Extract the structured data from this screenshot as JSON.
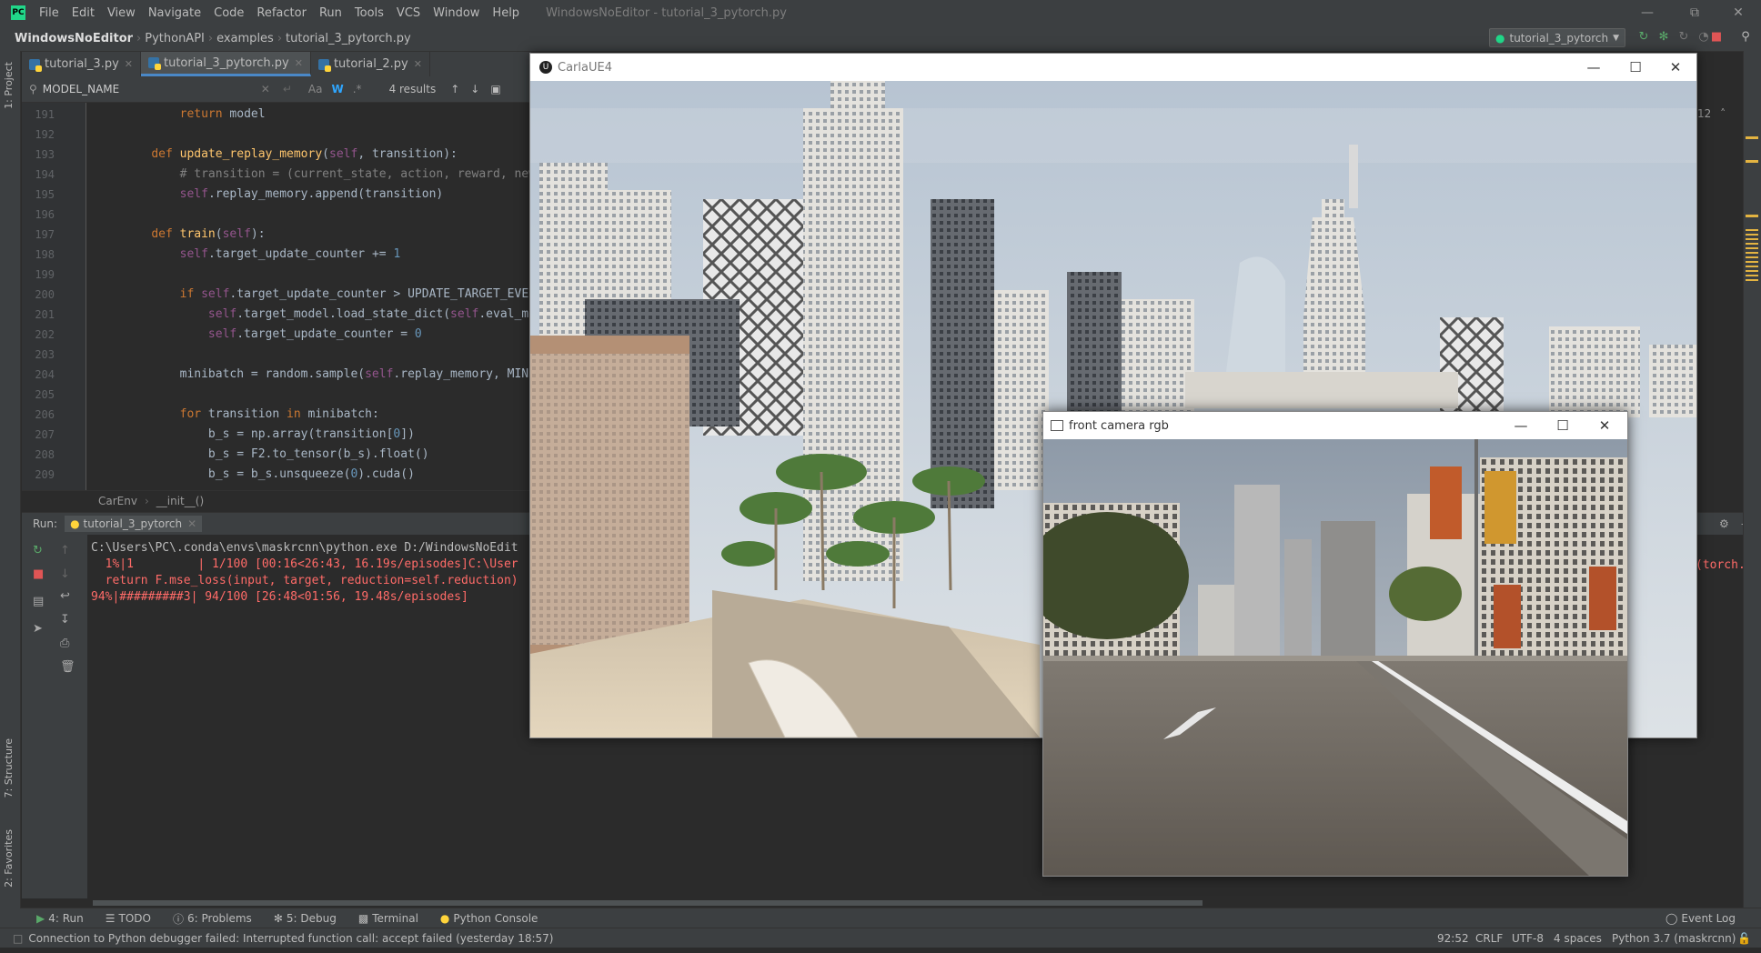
{
  "app": {
    "window_title": "WindowsNoEditor - tutorial_3_pytorch.py",
    "menu": [
      "File",
      "Edit",
      "View",
      "Navigate",
      "Code",
      "Refactor",
      "Run",
      "Tools",
      "VCS",
      "Window",
      "Help"
    ]
  },
  "nav": {
    "crumbs": [
      "WindowsNoEditor",
      "PythonAPI",
      "examples",
      "tutorial_3_pytorch.py"
    ],
    "run_config": "tutorial_3_pytorch"
  },
  "left_strip": {
    "project": "1: Project",
    "structure": "7: Structure",
    "favorites": "2: Favorites"
  },
  "tabs": [
    {
      "label": "tutorial_3.py"
    },
    {
      "label": "tutorial_3_pytorch.py"
    },
    {
      "label": "tutorial_2.py"
    }
  ],
  "search": {
    "query": "MODEL_NAME",
    "results": "4 results",
    "match_case": "Aa",
    "words": "W",
    "regex": ".*"
  },
  "editor": {
    "lines": [
      {
        "n": "191",
        "parts": [
          {
            "t": "        ",
            "c": ""
          },
          {
            "t": "return",
            "c": "kw"
          },
          {
            "t": " model",
            "c": ""
          }
        ]
      },
      {
        "n": "192",
        "parts": []
      },
      {
        "n": "193",
        "parts": [
          {
            "t": "    ",
            "c": ""
          },
          {
            "t": "def",
            "c": "kw"
          },
          {
            "t": " ",
            "c": ""
          },
          {
            "t": "update_replay_memory",
            "c": "fn"
          },
          {
            "t": "(",
            "c": ""
          },
          {
            "t": "self",
            "c": "self"
          },
          {
            "t": ", transition):",
            "c": ""
          }
        ]
      },
      {
        "n": "194",
        "parts": [
          {
            "t": "        # transition = (current_state, action, reward, new_s",
            "c": "cm"
          }
        ]
      },
      {
        "n": "195",
        "parts": [
          {
            "t": "        ",
            "c": ""
          },
          {
            "t": "self",
            "c": "self"
          },
          {
            "t": ".replay_memory.append(transition)",
            "c": ""
          }
        ]
      },
      {
        "n": "196",
        "parts": []
      },
      {
        "n": "197",
        "parts": [
          {
            "t": "    ",
            "c": ""
          },
          {
            "t": "def",
            "c": "kw"
          },
          {
            "t": " ",
            "c": ""
          },
          {
            "t": "train",
            "c": "fn"
          },
          {
            "t": "(",
            "c": ""
          },
          {
            "t": "self",
            "c": "self"
          },
          {
            "t": "):",
            "c": ""
          }
        ]
      },
      {
        "n": "198",
        "parts": [
          {
            "t": "        ",
            "c": ""
          },
          {
            "t": "self",
            "c": "self"
          },
          {
            "t": ".target_update_counter += ",
            "c": ""
          },
          {
            "t": "1",
            "c": "num"
          }
        ]
      },
      {
        "n": "199",
        "parts": []
      },
      {
        "n": "200",
        "parts": [
          {
            "t": "        ",
            "c": ""
          },
          {
            "t": "if",
            "c": "kw"
          },
          {
            "t": " ",
            "c": ""
          },
          {
            "t": "self",
            "c": "self"
          },
          {
            "t": ".target_update_counter > UPDATE_TARGET_EVERY",
            "c": ""
          }
        ]
      },
      {
        "n": "201",
        "parts": [
          {
            "t": "            ",
            "c": ""
          },
          {
            "t": "self",
            "c": "self"
          },
          {
            "t": ".target_model.load_state_dict(",
            "c": ""
          },
          {
            "t": "self",
            "c": "self"
          },
          {
            "t": ".eval_mode",
            "c": ""
          }
        ]
      },
      {
        "n": "202",
        "parts": [
          {
            "t": "            ",
            "c": ""
          },
          {
            "t": "self",
            "c": "self"
          },
          {
            "t": ".target_update_counter = ",
            "c": ""
          },
          {
            "t": "0",
            "c": "num"
          }
        ]
      },
      {
        "n": "203",
        "parts": []
      },
      {
        "n": "204",
        "parts": [
          {
            "t": "        minibatch = random.sample(",
            "c": ""
          },
          {
            "t": "self",
            "c": "self"
          },
          {
            "t": ".replay_memory, MINIBA",
            "c": ""
          }
        ]
      },
      {
        "n": "205",
        "parts": []
      },
      {
        "n": "206",
        "parts": [
          {
            "t": "        ",
            "c": ""
          },
          {
            "t": "for",
            "c": "kw"
          },
          {
            "t": " transition ",
            "c": ""
          },
          {
            "t": "in",
            "c": "kw"
          },
          {
            "t": " minibatch:",
            "c": ""
          }
        ]
      },
      {
        "n": "207",
        "parts": [
          {
            "t": "            b_s = np.array(transition[",
            "c": ""
          },
          {
            "t": "0",
            "c": "num"
          },
          {
            "t": "])",
            "c": ""
          }
        ]
      },
      {
        "n": "208",
        "parts": [
          {
            "t": "            b_s = F2.to_tensor(b_s).float()",
            "c": ""
          }
        ]
      },
      {
        "n": "209",
        "parts": [
          {
            "t": "            b_s = b_s.unsqueeze(",
            "c": ""
          },
          {
            "t": "0",
            "c": "num"
          },
          {
            "t": ").cuda()",
            "c": ""
          }
        ]
      }
    ],
    "inlay_count": "12",
    "breadcrumb": [
      "CarEnv",
      "__init__()"
    ]
  },
  "run": {
    "label": "Run:",
    "tab": "tutorial_3_pytorch",
    "console": [
      {
        "text": "C:\\Users\\PC\\.conda\\envs\\maskrcnn\\python.exe D:/WindowsNoEdit",
        "c": "white"
      },
      {
        "text": "  1%|1         | 1/100 [00:16<26:43, 16.19s/episodes]C:\\User",
        "c": "red"
      },
      {
        "text": "  return F.mse_loss(input, target, reduction=self.reduction)",
        "c": "red"
      },
      {
        "text": "94%|#########3| 94/100 [26:48<01:56, 19.48s/episodes]",
        "c": "red"
      }
    ],
    "overflow_text": "(torch.S"
  },
  "bottom_tabs": [
    "4: Run",
    "TODO",
    "6: Problems",
    "5: Debug",
    "Terminal",
    "Python Console"
  ],
  "event_log": "Event Log",
  "status": {
    "message": "Connection to Python debugger failed: Interrupted function call: accept failed (yesterday 18:57)",
    "position": "92:52",
    "line_sep": "CRLF",
    "encoding": "UTF-8",
    "indent": "4 spaces",
    "interpreter": "Python 3.7 (maskrcnn)"
  },
  "carla_window": {
    "title": "CarlaUE4"
  },
  "camera_window": {
    "title": "front camera rgb"
  },
  "colors": {
    "ide_bg": "#2b2b2b",
    "panel": "#3c3f41",
    "accent": "#4a88c7",
    "error": "#ff6b68"
  }
}
